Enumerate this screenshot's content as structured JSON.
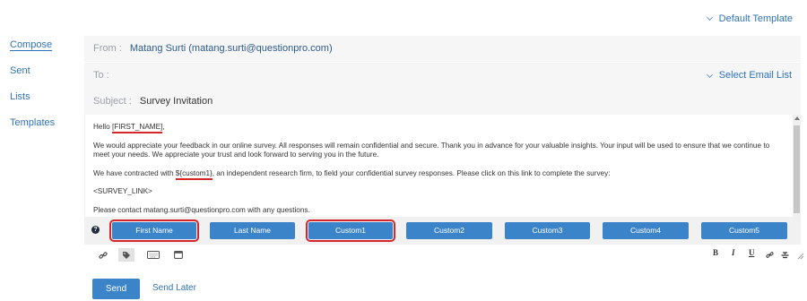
{
  "sidebar": {
    "items": [
      {
        "label": "Compose",
        "active": true
      },
      {
        "label": "Sent"
      },
      {
        "label": "Lists"
      },
      {
        "label": "Templates"
      }
    ]
  },
  "template_picker": {
    "label": "Default Template"
  },
  "from": {
    "label": "From :",
    "value": "Matang Surti (matang.surti@questionpro.com)"
  },
  "to": {
    "label": "To :",
    "select_list": "Select Email List"
  },
  "subject": {
    "label": "Subject :",
    "value": "Survey Invitation"
  },
  "editor": {
    "greeting_prefix": "Hello ",
    "first_name_token": "[FIRST_NAME]",
    "greeting_suffix": ",",
    "paragraph1": "We would appreciate your feedback in our online survey.  All responses will remain confidential and secure.  Thank you in advance for your valuable insights.  Your input will be used to ensure that we continue to meet your needs. We appreciate your trust and look forward to serving you in the future.",
    "paragraph2_prefix": "We have contracted with ",
    "custom_token": "${custom1}",
    "paragraph2_suffix": ", an independent research firm, to field your confidential survey responses.  Please click on this link to complete the survey:",
    "survey_link": "<SURVEY_LINK>",
    "contact_line": "Please contact matang.surti@questionpro.com with any questions."
  },
  "field_buttons": [
    "First Name",
    "Last Name",
    "Custom1",
    "Custom2",
    "Custom3",
    "Custom4",
    "Custom5"
  ],
  "help_glyph": "?",
  "format_buttons": {
    "bold": "B",
    "italic": "I",
    "underline": "U"
  },
  "actions": {
    "send": "Send",
    "send_later": "Send Later"
  },
  "colors": {
    "accent": "#3c84c9",
    "link": "#2e72b8",
    "highlight": "#d6262c"
  }
}
